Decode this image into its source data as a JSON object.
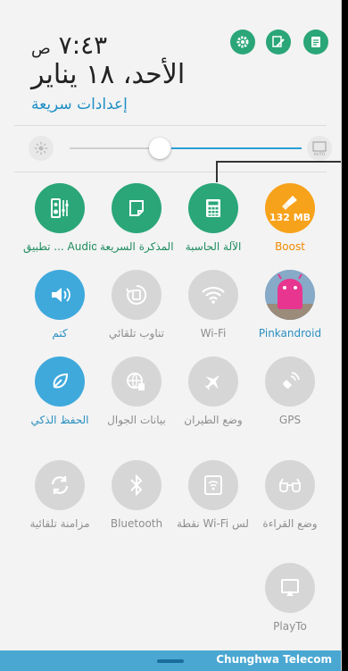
{
  "header": {
    "time": "٧:٤٣",
    "ampm": "ص",
    "date": "الأحد، ١٨ يناير",
    "quick_settings_label": "إعدادات سريعة"
  },
  "toolbar_icons": [
    "settings-icon",
    "edit-icon",
    "notes-icon"
  ],
  "brightness": {
    "level": 0.42,
    "auto_label": "AUTO"
  },
  "tiles": [
    {
      "label": "تطبيق ... Audio",
      "style": "green",
      "icon": "audio-equalizer-icon"
    },
    {
      "label": "المذكرة السريعة",
      "style": "green",
      "icon": "quick-memo-icon"
    },
    {
      "label": "الآلة الحاسبة",
      "style": "green",
      "icon": "calculator-icon"
    },
    {
      "label": "Boost",
      "style": "orange",
      "icon": "broom-icon",
      "value": "132 MB"
    },
    {
      "label": "كتم",
      "style": "blue",
      "icon": "volume-icon"
    },
    {
      "label": "تناوب تلقائي",
      "style": "gray",
      "icon": "auto-rotate-icon"
    },
    {
      "label": "Wi-Fi",
      "style": "gray",
      "icon": "wifi-icon"
    },
    {
      "label": "Pinkandroid",
      "style": "blue-text",
      "icon": "pink-android-avatar"
    },
    {
      "label": "الحفظ الذكي",
      "style": "blue",
      "icon": "leaf-icon"
    },
    {
      "label": "بيانات الجوال",
      "style": "gray",
      "icon": "mobile-data-icon"
    },
    {
      "label": "وضع الطيران",
      "style": "gray",
      "icon": "airplane-icon"
    },
    {
      "label": "GPS",
      "style": "gray",
      "icon": "gps-icon"
    },
    {
      "label": "مزامنة تلقائية",
      "style": "gray",
      "icon": "sync-icon"
    },
    {
      "label": "Bluetooth",
      "style": "gray",
      "icon": "bluetooth-icon"
    },
    {
      "label": "نقطة Wi-Fi الس...",
      "style": "gray",
      "icon": "hotspot-icon"
    },
    {
      "label": "وضع القراءة",
      "style": "gray",
      "icon": "reading-glasses-icon"
    },
    {
      "label": "PlayTo",
      "style": "gray",
      "icon": "playto-icon"
    }
  ],
  "status": {
    "carrier": "Chunghwa Telecom"
  },
  "colors": {
    "green": "#2aa679",
    "blue": "#3fa9dc",
    "orange": "#f7a21b",
    "gray": "#d6d6d6",
    "navbar": "#4aa7d1"
  }
}
